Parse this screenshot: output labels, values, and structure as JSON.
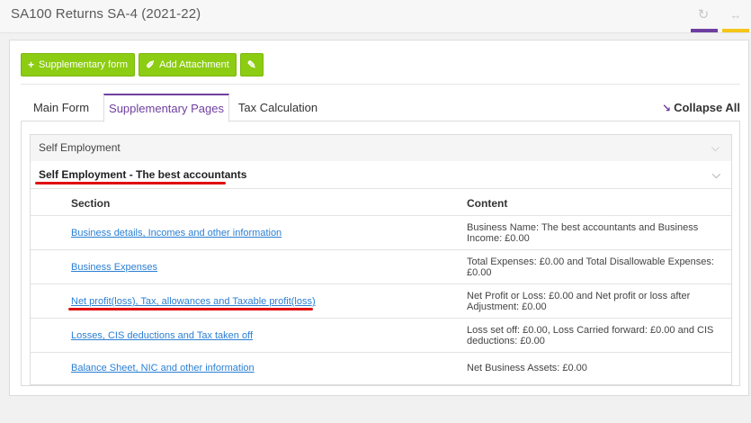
{
  "header": {
    "title": "SA100 Returns SA-4 (2021-22)",
    "refresh_icon": "refresh-icon",
    "expand_icon": "expand-arrows-icon",
    "accent_purple": "#6f3fa0",
    "accent_yellow": "#f5c518"
  },
  "toolbar": {
    "supplementary_label": "Supplementary form",
    "attachment_label": "Add Attachment",
    "edit_icon": "edit-icon",
    "button_color": "#8ccc12"
  },
  "tabs": {
    "main_form": "Main Form",
    "supplementary_pages": "Supplementary Pages",
    "tax_calculation": "Tax Calculation",
    "collapse_all": "Collapse All"
  },
  "accordion": {
    "title": "Self Employment",
    "sub_title": "Self Employment - The best accountants",
    "columns": {
      "section": "Section",
      "content": "Content"
    },
    "rows": [
      {
        "section": "Business details, Incomes and other information",
        "content": "Business Name: The best accountants and Business Income: £0.00"
      },
      {
        "section": "Business Expenses",
        "content": "Total Expenses: £0.00 and Total Disallowable Expenses: £0.00"
      },
      {
        "section": "Net profit(loss), Tax, allowances and Taxable profit(loss)",
        "content": "Net Profit or Loss: £0.00 and Net profit or loss after Adjustment: £0.00"
      },
      {
        "section": "Losses, CIS deductions and Tax taken off",
        "content": "Loss set off: £0.00, Loss Carried forward: £0.00 and CIS deductions: £0.00"
      },
      {
        "section": "Balance Sheet, NIC and other information",
        "content": "Net Business Assets: £0.00"
      }
    ]
  }
}
